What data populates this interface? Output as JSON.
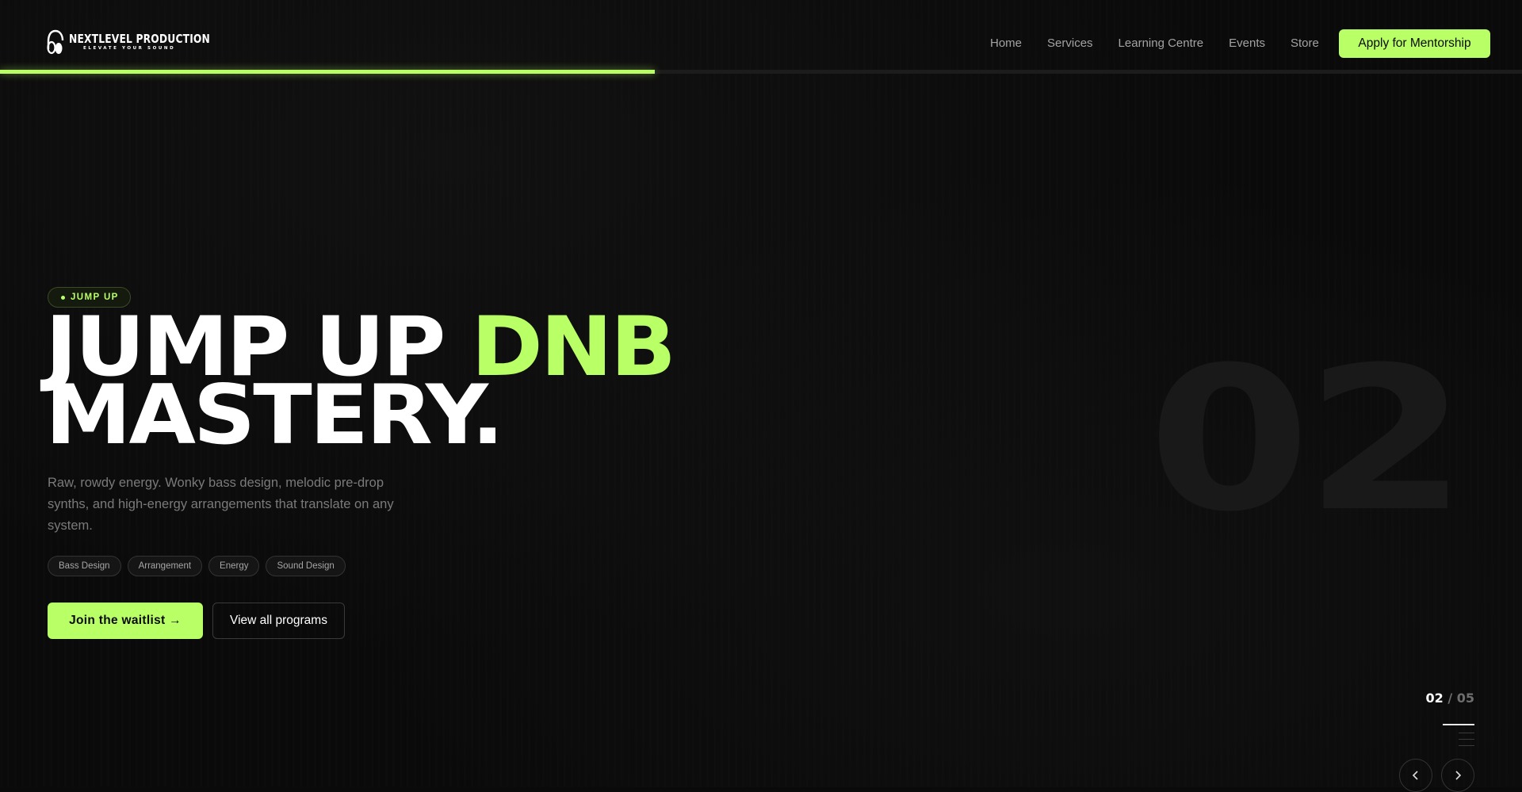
{
  "brand": {
    "name": "NEXTLEVEL PRODUCTION",
    "tagline": "ELEVATE YOUR SOUND",
    "accent_color": "#b9ff66",
    "logo_icon": "headphones-logo-icon"
  },
  "nav": {
    "items": [
      {
        "label": "Home"
      },
      {
        "label": "Services"
      },
      {
        "label": "Learning Centre"
      },
      {
        "label": "Events"
      },
      {
        "label": "Store"
      }
    ],
    "cta_label": "Apply for Mentorship"
  },
  "slider_progress": 0.43,
  "hero": {
    "badge": "JUMP UP",
    "headline_part1": "JUMP UP ",
    "headline_accent": "DNB",
    "headline_line2": "MASTERY.",
    "description": "Raw, rowdy energy. Wonky bass design, melodic pre-drop synths, and high-energy arrangements that translate on any system.",
    "tags": [
      "Bass Design",
      "Arrangement",
      "Energy",
      "Sound Design"
    ],
    "primary_cta": "Join the waitlist →",
    "secondary_cta": "View all programs",
    "slide_number": "02"
  },
  "slider": {
    "current": "02",
    "separator": "/",
    "total": "05",
    "prev_icon": "chevron-left-icon",
    "next_icon": "chevron-right-icon"
  }
}
